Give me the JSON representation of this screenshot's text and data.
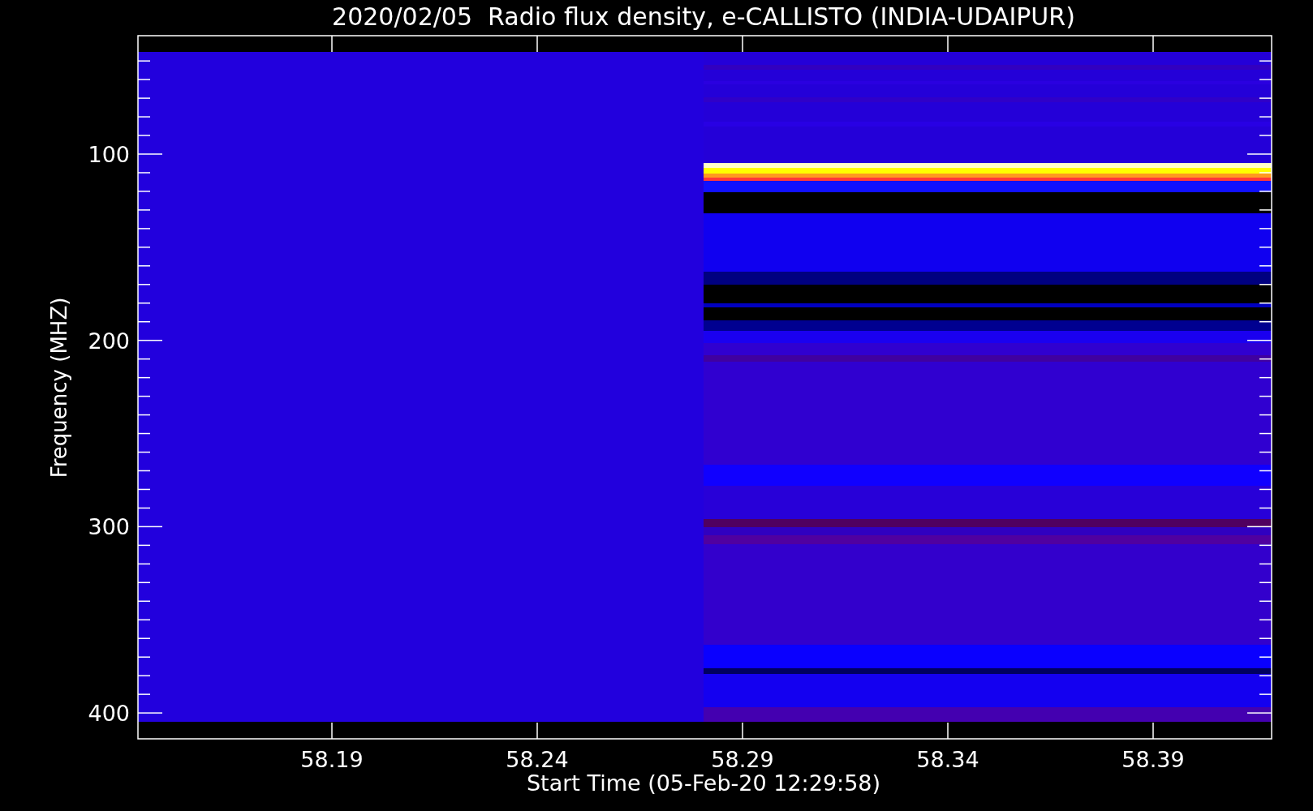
{
  "title": "2020/02/05  Radio flux density, e-CALLISTO (INDIA-UDAIPUR)",
  "y_axis": {
    "label": "Frequency (MHZ)",
    "ticks": [
      "100",
      "200",
      "300",
      "400"
    ]
  },
  "x_axis": {
    "label": "Start Time (05-Feb-20 12:29:58)",
    "ticks": [
      "58.19",
      "58.24",
      "58.29",
      "58.34",
      "58.39"
    ]
  }
}
